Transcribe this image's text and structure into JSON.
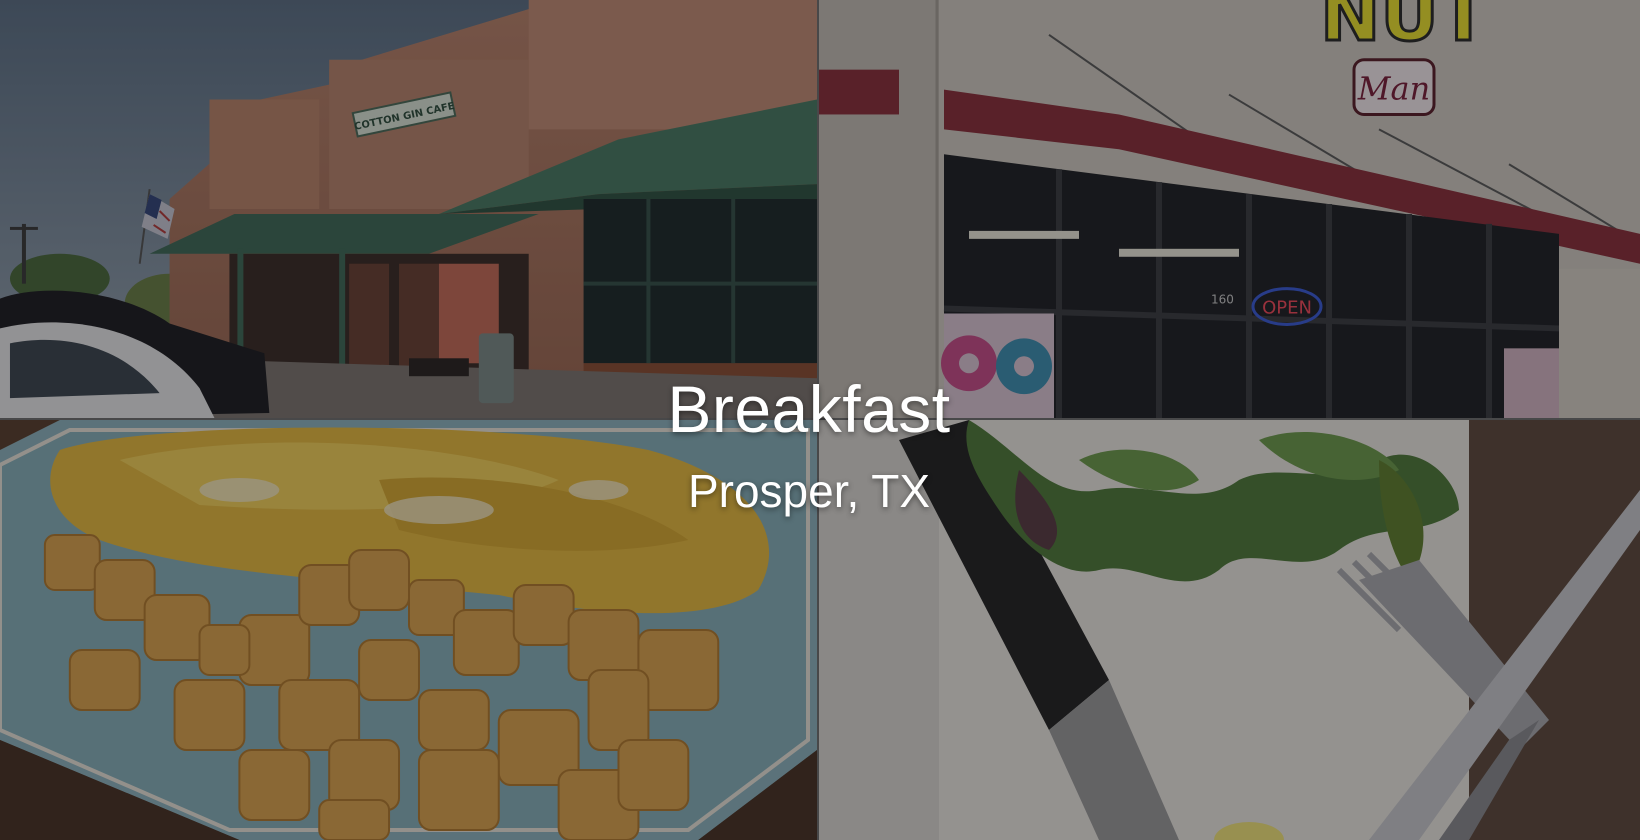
{
  "hero": {
    "title": "Breakfast",
    "subtitle": "Prosper, TX"
  },
  "tiles": {
    "top_left": {
      "sign_text": "COTTON GIN CAFE"
    },
    "top_right": {
      "sign_text": "NUT",
      "sign_script": "Man",
      "open_sign": "OPEN",
      "address_number": "160"
    }
  },
  "colors": {
    "overlay": "#0a0a0e",
    "title_text": "#ffffff",
    "awning_green": "#3f6a57",
    "awning_red": "#8a2f3b",
    "plate_blue": "#7fa9b6",
    "egg_yellow": "#e0b43a"
  }
}
